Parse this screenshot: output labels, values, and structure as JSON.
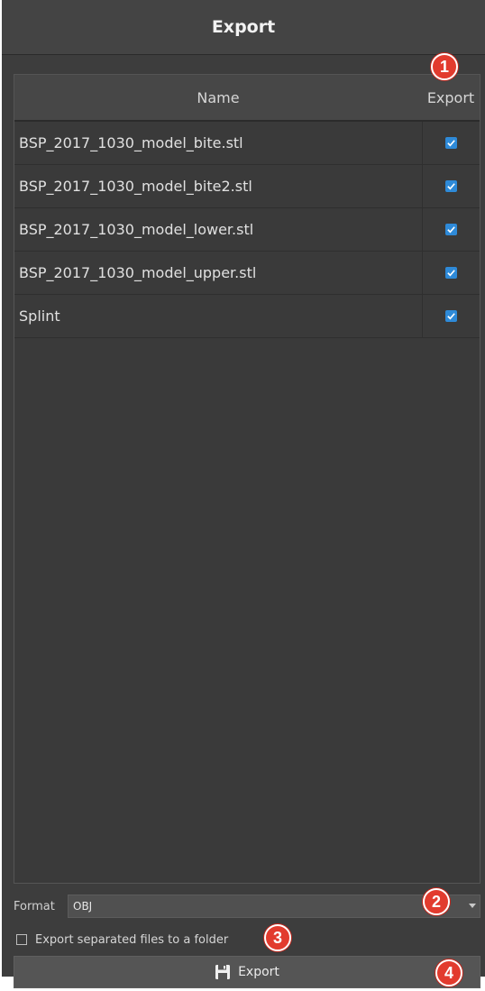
{
  "title": "Export",
  "table": {
    "columns": {
      "name": "Name",
      "export": "Export"
    },
    "rows": [
      {
        "name": "BSP_2017_1030_model_bite.stl",
        "checked": true
      },
      {
        "name": "BSP_2017_1030_model_bite2.stl",
        "checked": true
      },
      {
        "name": "BSP_2017_1030_model_lower.stl",
        "checked": true
      },
      {
        "name": "BSP_2017_1030_model_upper.stl",
        "checked": true
      },
      {
        "name": "Splint",
        "checked": true
      }
    ]
  },
  "format": {
    "label": "Format",
    "value": "OBJ"
  },
  "separate_files": {
    "label": "Export separated files to a folder",
    "checked": false
  },
  "export_button": {
    "label": "Export",
    "icon": "save-icon"
  },
  "badges": [
    "1",
    "2",
    "3",
    "4"
  ],
  "colors": {
    "accent_check": "#2e8ad8",
    "badge": "#e23b2e"
  }
}
